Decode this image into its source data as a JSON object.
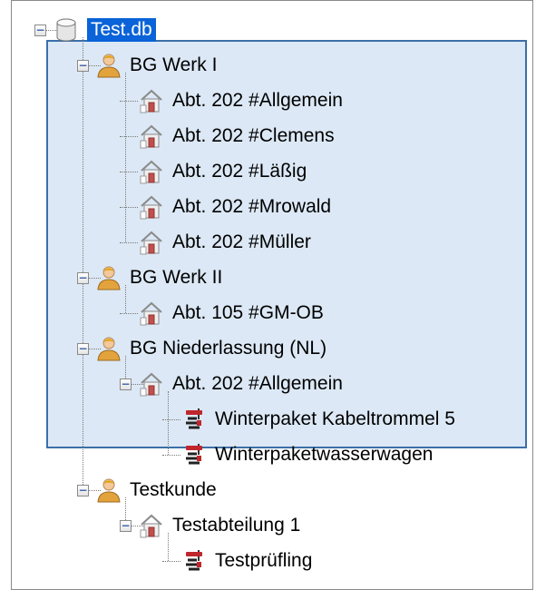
{
  "tree": {
    "root": {
      "label": "Test.db",
      "icon": "database-icon",
      "expanded": true,
      "selected": true
    },
    "groups": [
      {
        "label": "BG Werk I",
        "icon": "user-icon",
        "expanded": true,
        "children": [
          {
            "label": "Abt. 202 #Allgemein",
            "icon": "house-icon",
            "expanded": false
          },
          {
            "label": "Abt. 202 #Clemens",
            "icon": "house-icon",
            "expanded": false
          },
          {
            "label": "Abt. 202 #Läßig",
            "icon": "house-icon",
            "expanded": false
          },
          {
            "label": "Abt. 202 #Mrowald",
            "icon": "house-icon",
            "expanded": false
          },
          {
            "label": "Abt. 202 #Müller",
            "icon": "house-icon",
            "expanded": false
          }
        ]
      },
      {
        "label": "BG Werk II",
        "icon": "user-icon",
        "expanded": true,
        "children": [
          {
            "label": "Abt. 105 #GM-OB",
            "icon": "house-icon",
            "expanded": false
          }
        ]
      },
      {
        "label": "BG Niederlassung (NL)",
        "icon": "user-icon",
        "expanded": true,
        "children": [
          {
            "label": "Abt. 202 #Allgemein",
            "icon": "house-icon",
            "expanded": true,
            "children": [
              {
                "label": "Winterpaket Kabeltrommel 5",
                "icon": "cable-reel-icon"
              },
              {
                "label": "Winterpaketwasserwagen",
                "icon": "cable-reel-icon"
              }
            ]
          }
        ]
      },
      {
        "label": "Testkunde",
        "icon": "user-icon",
        "expanded": true,
        "children": [
          {
            "label": "Testabteilung 1",
            "icon": "house-icon",
            "expanded": true,
            "children": [
              {
                "label": "Testprüfling",
                "icon": "cable-reel-icon"
              }
            ]
          }
        ]
      }
    ]
  },
  "colors": {
    "selection_fill": "#dce8f5",
    "selection_border": "#3b6fa8",
    "root_highlight": "#0a63d8"
  }
}
